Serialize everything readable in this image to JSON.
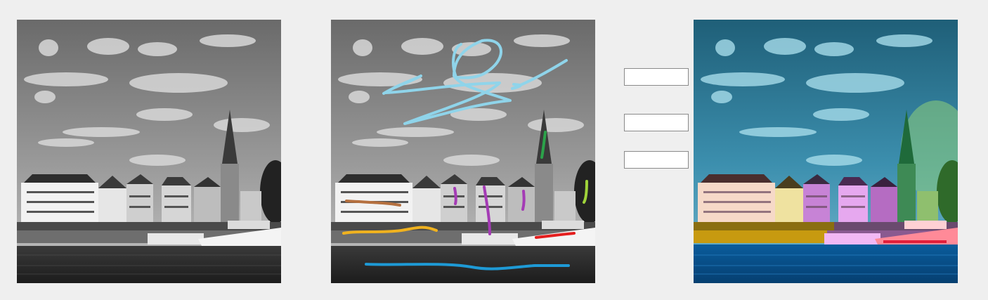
{
  "panels": {
    "original": {
      "kind": "grayscale-photo",
      "subject": "lakeside-town"
    },
    "scribble": {
      "kind": "grayscale-photo-with-color-strokes",
      "stroke_colors": {
        "sky": "#8fd4ea",
        "water": "#1e9ad6",
        "shore": "#f0b21f",
        "hotel": "#b5703f",
        "tower": "#2ca24a",
        "right_tree": "#9fd33a",
        "houses": "#a43bb5",
        "boat": "#e41e1e"
      }
    },
    "result": {
      "kind": "colorized-photo",
      "tints": {
        "sky": "#2f8fb3",
        "water": "#0b6fb8",
        "shore": "#c79a10",
        "hotel": "#f3c2b3",
        "tower": "#2e9d55",
        "houses": "#d36fe0",
        "boat": "#ff5566",
        "trees": "#5fb84a"
      }
    }
  },
  "buttons": [
    "",
    "",
    ""
  ]
}
